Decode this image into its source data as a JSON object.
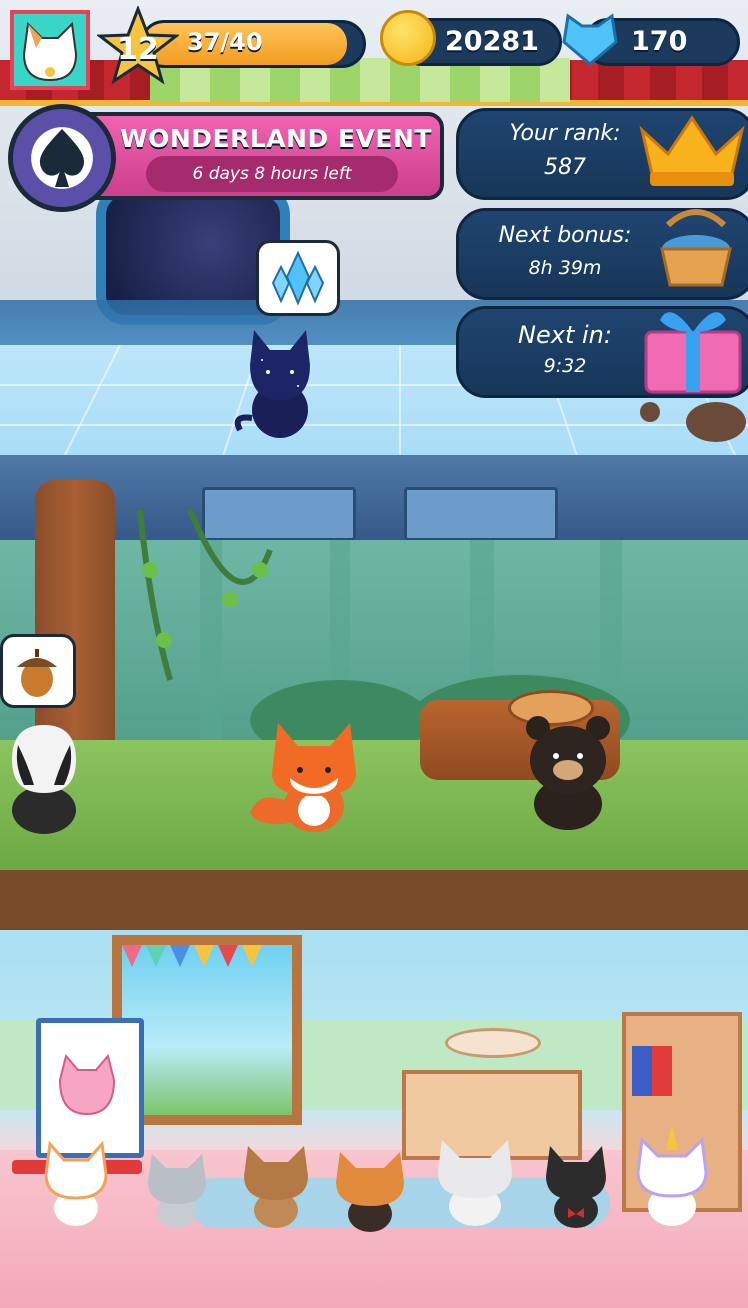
{
  "hud": {
    "level": "12",
    "xp_text": "37/40",
    "xp_progress": 0.925,
    "coins": "20281",
    "gems": "170"
  },
  "event": {
    "title": "WONDERLAND EVENT",
    "time_left": "6 days 8 hours  left"
  },
  "side_panels": {
    "rank_label": "Your rank:",
    "rank_value": "587",
    "bonus_label": "Next bonus:",
    "bonus_value": "8h 39m",
    "next_label": "Next in:",
    "next_value": "9:32"
  },
  "colors": {
    "xp_fill": "#f39c1f",
    "coin": "#f5c518",
    "gem": "#4fc3f7",
    "event_banner": "#d94d9a"
  },
  "icons": {
    "spade": "spade-icon",
    "crown": "crown-icon",
    "basket": "yarn-basket-icon",
    "gift": "gift-icon",
    "crystal": "crystal-bubble-icon",
    "acorn": "acorn-bubble-icon"
  }
}
